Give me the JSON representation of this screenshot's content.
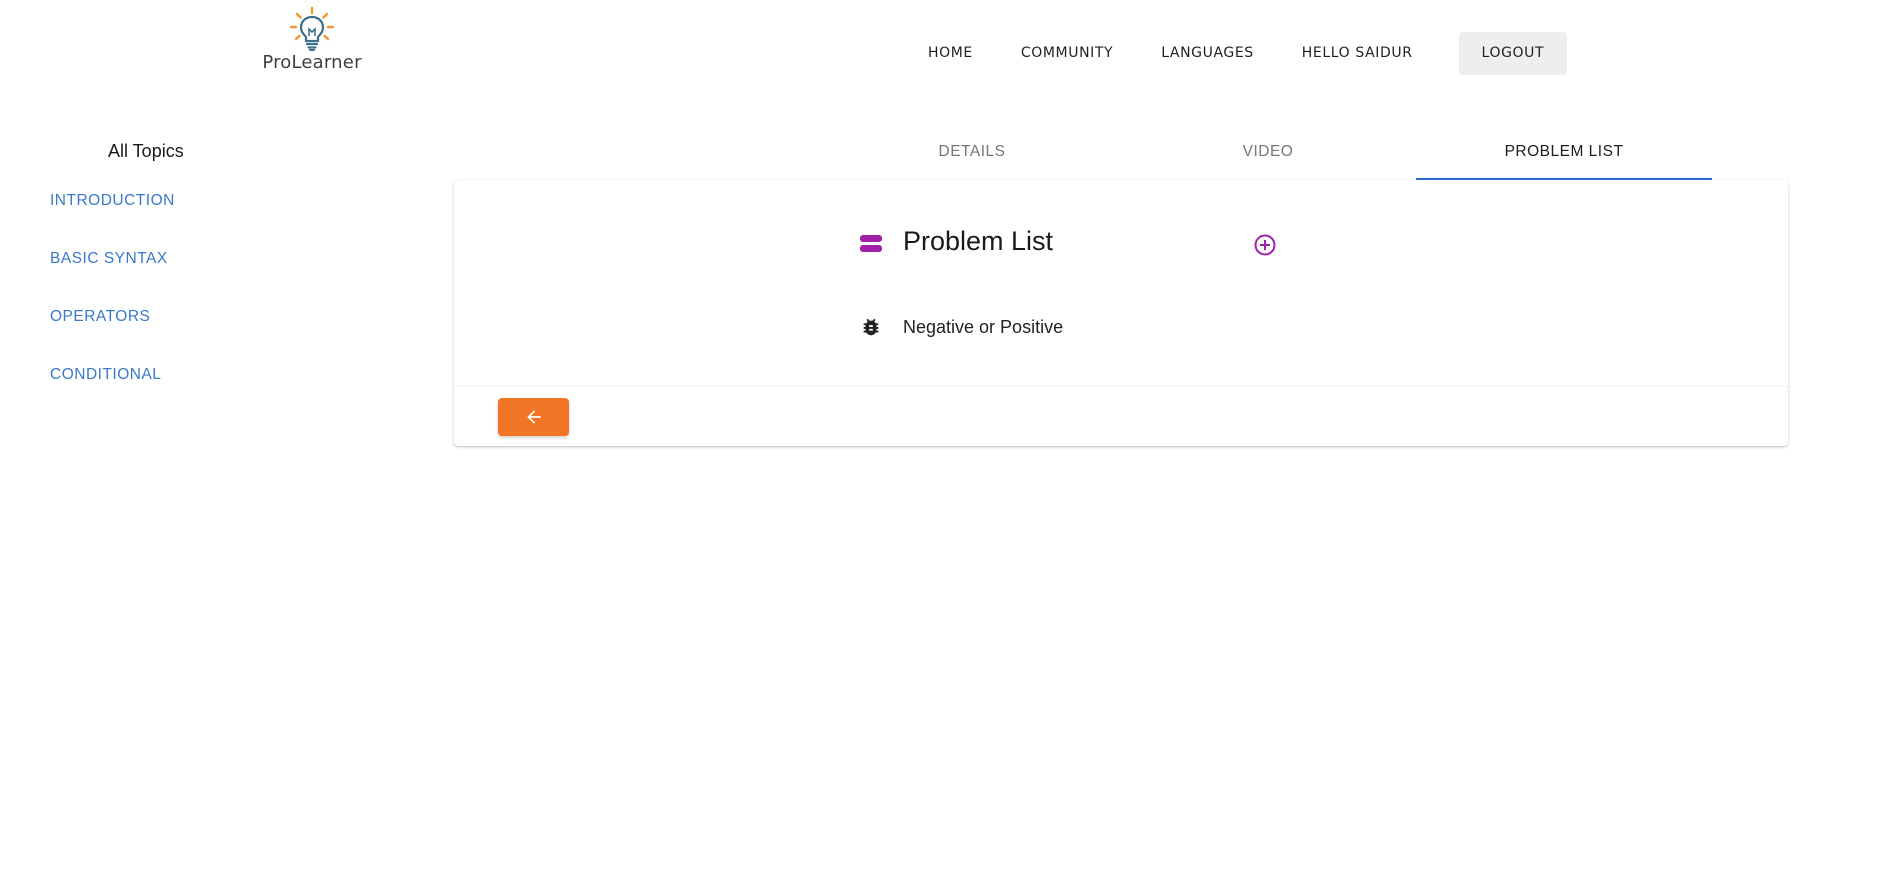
{
  "brand": {
    "name": "ProLearner",
    "icon": "lightbulb-icon"
  },
  "nav": {
    "home": "HOME",
    "community": "COMMUNITY",
    "languages": "LANGUAGES",
    "greeting": "HELLO SAIDUR",
    "logout": "LOGOUT"
  },
  "sidebar": {
    "title": "All Topics",
    "items": [
      {
        "label": "INTRODUCTION"
      },
      {
        "label": "BASIC SYNTAX"
      },
      {
        "label": "OPERATORS"
      },
      {
        "label": "CONDITIONAL"
      }
    ]
  },
  "tabs": [
    {
      "label": "DETAILS",
      "active": false
    },
    {
      "label": "VIDEO",
      "active": false
    },
    {
      "label": "PROBLEM LIST",
      "active": true
    }
  ],
  "problem_list": {
    "title": "Problem List",
    "title_icon": "list-icon",
    "add_icon": "add-circle-icon",
    "problems": [
      {
        "name": "Negative or Positive",
        "icon": "bug-icon"
      }
    ]
  },
  "back_button": {
    "icon": "arrow-left-icon"
  },
  "colors": {
    "accent_blue": "#2f6fd1",
    "link_blue": "#3a78c9",
    "purple": "#a020a8",
    "orange": "#f27425",
    "logo_bulb": "#3d6f8c",
    "logo_rays": "#f0962a"
  }
}
